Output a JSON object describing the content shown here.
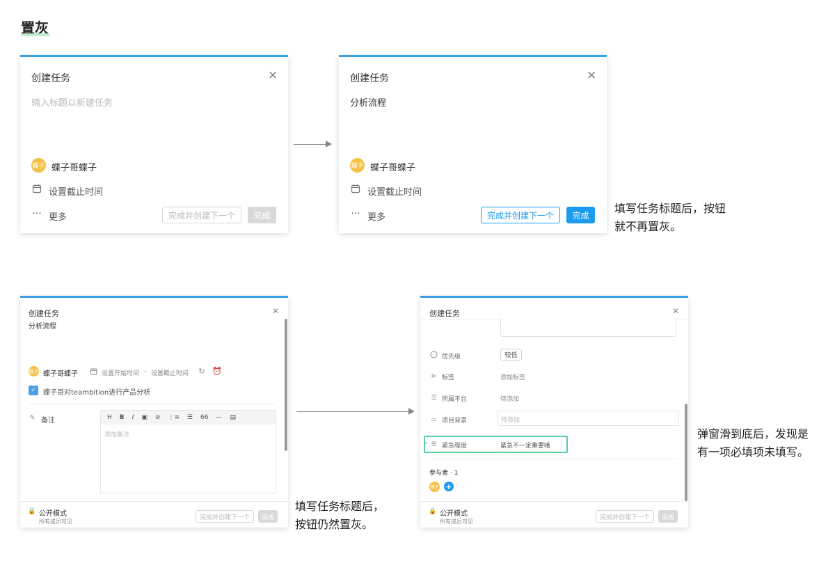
{
  "page": {
    "title": "置灰"
  },
  "panel1": {
    "title": "创建任务",
    "close": "✕",
    "input_placeholder": "输入标题以新建任务",
    "user": {
      "avatar": "蝶子",
      "name": "蝶子哥蝶子"
    },
    "due_label": "设置截止时间",
    "more_label": "更多",
    "btn_next": "完成并创建下一个",
    "btn_done": "完成"
  },
  "panel2": {
    "title": "创建任务",
    "close": "✕",
    "input_value": "分析流程",
    "user": {
      "avatar": "蝶子",
      "name": "蝶子哥蝶子"
    },
    "due_label": "设置截止时间",
    "more_label": "更多",
    "btn_next": "完成并创建下一个",
    "btn_done": "完成"
  },
  "caption1": {
    "line1": "填写任务标题后，按钮",
    "line2": "就不再置灰。"
  },
  "panel3": {
    "title": "创建任务",
    "close": "✕",
    "input_value": "分析流程",
    "user": {
      "avatar": "蝶子",
      "name": "蝶子哥蝶子"
    },
    "start_label": "设置开始时间",
    "dash": "-",
    "due_label": "设置截止时间",
    "project": "蝶子哥对teambition进行产品分析",
    "note_label": "备注",
    "toolbar": [
      "H",
      "B",
      "I",
      "▣",
      "⊘",
      "⋮≡",
      "☰",
      "66",
      "—",
      "▤"
    ],
    "note_placeholder": "添加备注",
    "mode_label": "公开模式",
    "mode_desc": "所有成员可见",
    "btn_next": "完成并创建下一个",
    "btn_done": "完成"
  },
  "caption2": {
    "line1": "填写任务标题后，",
    "line2": "按钮仍然置灰。"
  },
  "panel4": {
    "title": "创建任务",
    "close": "✕",
    "priority_label": "优先级",
    "priority_value": "较低",
    "tag_label": "标签",
    "tag_value": "添加标签",
    "platform_label": "所属平台",
    "platform_value": "待添加",
    "background_label": "项目背景",
    "background_value": "待添加",
    "urgency_label": "紧急程度",
    "urgency_value": "紧急不一定重要哦",
    "participants_label": "参与者 · 1",
    "participant_avatar": "蝶子",
    "mode_label": "公开模式",
    "mode_desc": "所有成员可见",
    "btn_next": "完成并创建下一个",
    "btn_done": "完成"
  },
  "caption3": {
    "line1": "弹窗滑到底后，发现是",
    "line2": "有一项必填项未填写。"
  },
  "colors": {
    "accent": "#1b9aee",
    "highlight": "#55d09a",
    "avatar": "#f4c146",
    "disabled": "#d9d9d9"
  }
}
